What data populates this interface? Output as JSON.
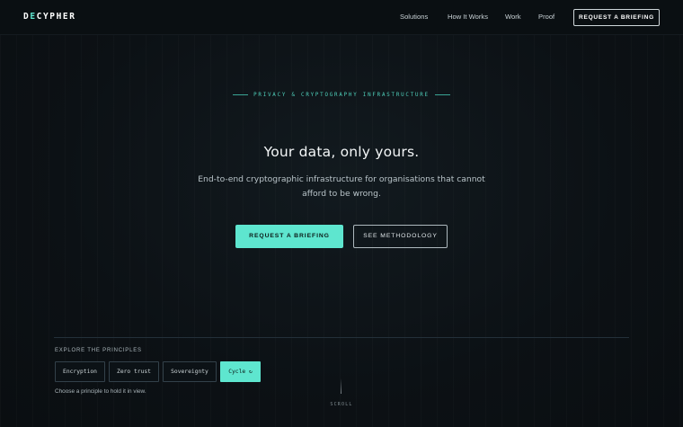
{
  "brand": {
    "logo_prefix": "D",
    "logo_accent": "E",
    "logo_suffix": "CYPHER",
    "accent_color": "#5ee6cf"
  },
  "nav": {
    "links": [
      "Solutions",
      "How It Works",
      "Work",
      "Proof"
    ],
    "cta_label": "REQUEST A BRIEFING"
  },
  "hero": {
    "eyebrow": "PRIVACY & CRYPTOGRAPHY INFRASTRUCTURE",
    "headline": "Your data, only yours.",
    "subhead": "End-to-end cryptographic infrastructure for organisations that cannot afford to be wrong.",
    "primary_cta": "REQUEST A BRIEFING",
    "secondary_cta": "SEE METHODOLOGY"
  },
  "principles": {
    "label": "EXPLORE THE PRINCIPLES",
    "chips": [
      "Encryption",
      "Zero trust",
      "Sovereignty",
      "Cycle ↻"
    ],
    "active_index": 3,
    "hint": "Choose a principle to hold it in view."
  },
  "scroll": {
    "label": "SCROLL"
  }
}
